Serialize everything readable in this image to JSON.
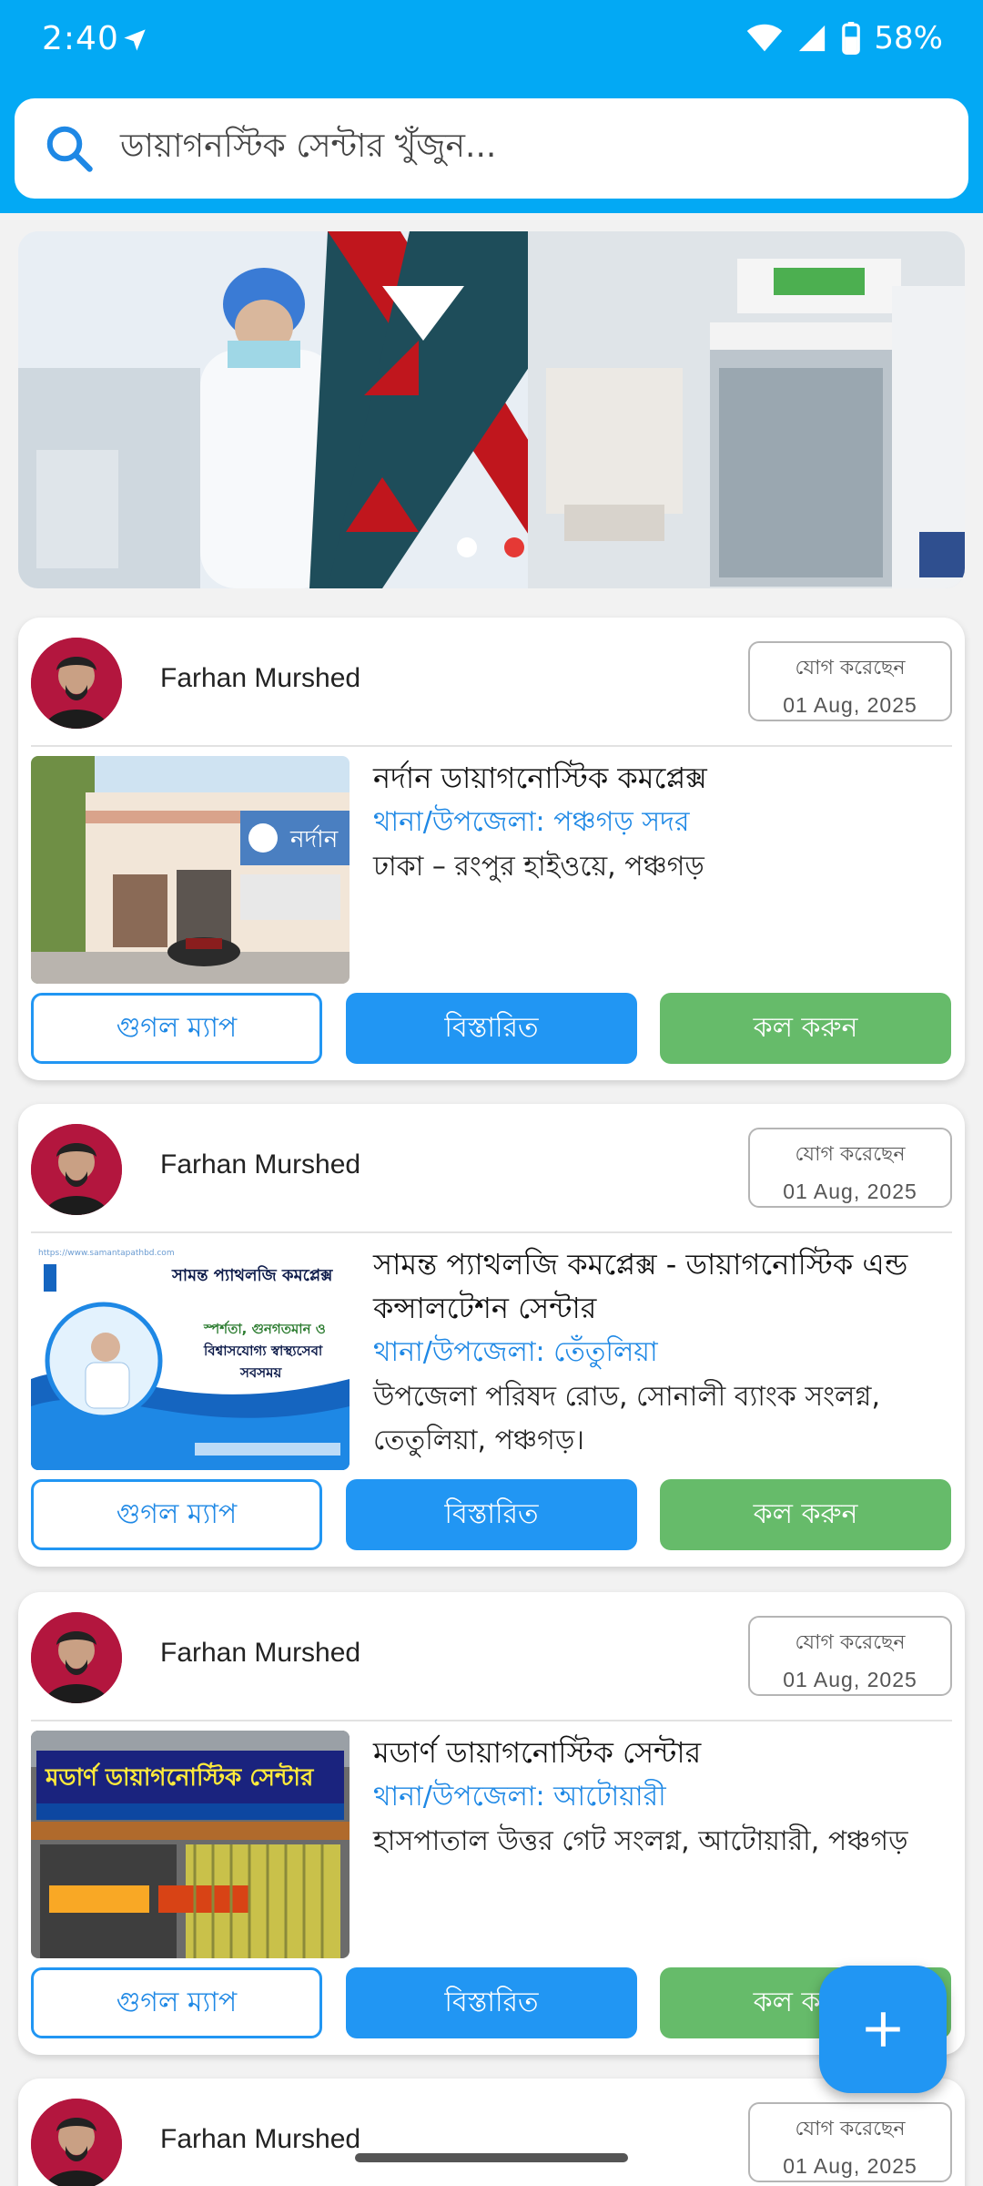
{
  "status_bar": {
    "time": "2:40",
    "battery": "58%"
  },
  "search": {
    "placeholder": "ডায়াগনস্টিক সেন্টার খুঁজুন..."
  },
  "banner": {
    "slide_count": 2,
    "active_slide": 2
  },
  "cards": [
    {
      "user_name": "Farhan Murshed",
      "joined_label": "যোগ করেছেন",
      "joined_date": "01 Aug, 2025",
      "center_name": "নর্দান ডায়াগনোস্টিক কমপ্লেক্স",
      "area": "থানা/উপজেলা: পঞ্চগড় সদর",
      "address": "ঢাকা – রংপুর হাইওয়ে, পঞ্চগড়",
      "map_label": "গুগল ম্যাপ",
      "details_label": "বিস্তারিত",
      "call_label": "কল করুন"
    },
    {
      "user_name": "Farhan Murshed",
      "joined_label": "যোগ করেছেন",
      "joined_date": "01 Aug, 2025",
      "center_name": "সামন্ত প্যাথলজি কমপ্লেক্স - ডায়াগনোস্টিক এন্ড কন্সালটেশন সেন্টার",
      "area": "থানা/উপজেলা: তেঁতুলিয়া",
      "address": "উপজেলা পরিষদ রোড, সোনালী ব্যাংক সংলগ্ন, তেতুলিয়া, পঞ্চগড়।",
      "map_label": "গুগল ম্যাপ",
      "details_label": "বিস্তারিত",
      "call_label": "কল করুন"
    },
    {
      "user_name": "Farhan Murshed",
      "joined_label": "যোগ করেছেন",
      "joined_date": "01 Aug, 2025",
      "center_name": "মডার্ণ ডায়াগনোস্টিক সেন্টার",
      "area": "থানা/উপজেলা: আটোয়ারী",
      "address": "হাসপাতাল উত্তর গেট সংলগ্ন, আটোয়ারী, পঞ্চগড়",
      "map_label": "গুগল ম্যাপ",
      "details_label": "বিস্তারিত",
      "call_label": "কল করুন"
    },
    {
      "user_name": "Farhan Murshed",
      "joined_label": "যোগ করেছেন",
      "joined_date": "01 Aug, 2025"
    }
  ],
  "thumb_texts": {
    "card1_sign": "নর্দান",
    "card2_title": "সামন্ত প্যাথলজি কমপ্লেক্স",
    "card2_slogan1": "স্পর্শতা, গুনগতমান ও",
    "card2_slogan2": "বিশ্বাসযোগ্য স্বাস্থ্যসেবা",
    "card2_slogan3": "সবসময়",
    "card2_url": "https://www.samantapathbd.com",
    "card3_sign": "মডার্ণ ডায়াগনোস্টিক সেন্টার"
  },
  "fab": {
    "icon": "plus-icon"
  },
  "colors": {
    "primary": "#03a9f4",
    "button_blue": "#2196f3",
    "button_green": "#66bb6a",
    "area_text": "#1e88e5"
  }
}
